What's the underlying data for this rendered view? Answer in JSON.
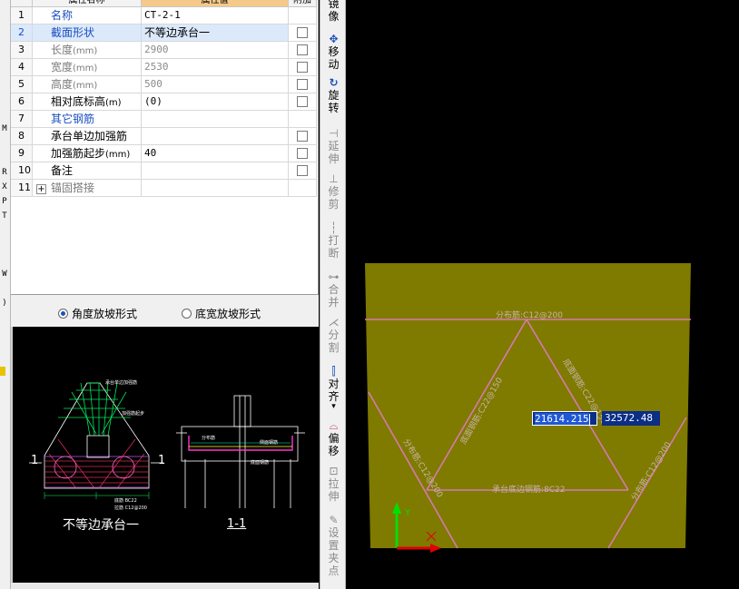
{
  "left_sliver": {
    "letters": [
      "M",
      "R",
      "X",
      "P",
      "T",
      "W",
      ")"
    ]
  },
  "property_panel": {
    "header": {
      "num": "",
      "name": "属性名称",
      "value": "属性值",
      "add": "附加"
    },
    "rows": [
      {
        "num": "1",
        "name": "名称",
        "value": "CT-2-1",
        "checkbox": false
      },
      {
        "num": "2",
        "name": "截面形状",
        "value": "不等边承台一",
        "checkbox": true
      },
      {
        "num": "3",
        "name": "长度",
        "unit": "(mm)",
        "value": "2900",
        "checkbox": true
      },
      {
        "num": "4",
        "name": "宽度",
        "unit": "(mm)",
        "value": "2530",
        "checkbox": true
      },
      {
        "num": "5",
        "name": "高度",
        "unit": "(mm)",
        "value": "500",
        "checkbox": true
      },
      {
        "num": "6",
        "name": "相对底标高",
        "unit": "(m)",
        "value": "(0)",
        "checkbox": true
      },
      {
        "num": "7",
        "name": "其它钢筋",
        "value": "",
        "checkbox": false
      },
      {
        "num": "8",
        "name": "承台单边加强筋",
        "value": "",
        "checkbox": true
      },
      {
        "num": "9",
        "name": "加强筋起步",
        "unit": "(mm)",
        "value": "40",
        "checkbox": true
      },
      {
        "num": "10",
        "name": "备注",
        "value": "",
        "checkbox": true
      },
      {
        "num": "11",
        "name": "锚固搭接",
        "value": "",
        "checkbox": false,
        "expand": "+"
      }
    ]
  },
  "radio_options": [
    {
      "label": "角度放坡形式",
      "selected": true
    },
    {
      "label": "底宽放坡形式",
      "selected": false
    }
  ],
  "preview": {
    "caption": "不等边承台一",
    "section_label": "1-1",
    "marker_left": "1",
    "marker_right": "1",
    "annotations": {
      "top_left": "承台单边加强筋",
      "mid_left": "加强筋起步",
      "bottom_1": "底筋 BC22",
      "bottom_2": "拉筋 C12@200",
      "right_1": "分布筋",
      "right_2": "侧面钢筋",
      "right_3": "底面钢筋"
    }
  },
  "toolbar": [
    {
      "icon": "mirror-icon",
      "label": "镜像",
      "enabled": true
    },
    {
      "icon": "move-icon",
      "label": "移动",
      "enabled": true
    },
    {
      "icon": "rotate-icon",
      "label": "旋转",
      "enabled": true
    },
    {
      "icon": "extend-icon",
      "label": "延伸",
      "enabled": false
    },
    {
      "icon": "trim-icon",
      "label": "修剪",
      "enabled": false
    },
    {
      "icon": "break-icon",
      "label": "打断",
      "enabled": false
    },
    {
      "icon": "merge-icon",
      "label": "合并",
      "enabled": false
    },
    {
      "icon": "split-icon",
      "label": "分割",
      "enabled": false
    },
    {
      "icon": "align-icon",
      "label": "对齐",
      "enabled": true,
      "dropdown": "▾"
    },
    {
      "icon": "offset-icon",
      "label": "偏移",
      "enabled": true
    },
    {
      "icon": "stretch-icon",
      "label": "拉伸",
      "enabled": false
    },
    {
      "icon": "set-point-icon",
      "label": "设置夹点",
      "enabled": false
    }
  ],
  "canvas": {
    "coord_x": "21614.215",
    "coord_y": "32572.48",
    "labels": {
      "top_bar": "分布筋:C12@200",
      "left_upper": "底面钢筋:C22@150",
      "right_upper": "底面钢筋:C22@150",
      "left_lower": "分布筋:C12@200",
      "bottom_bar": "承台底边钢筋:8C22",
      "right_lower": "分布筋:C12@200"
    },
    "axis_y": "Y",
    "axis_x": "X",
    "colors": {
      "fill": "#7f7a00",
      "rebar": "#d67ab0",
      "axis_y": "#00e000",
      "axis_x": "#e00000"
    }
  }
}
